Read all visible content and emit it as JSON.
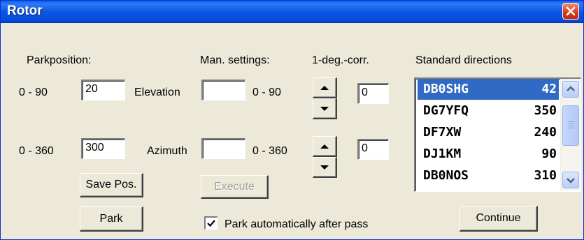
{
  "window": {
    "title": "Rotor",
    "close_icon": "close-x-icon"
  },
  "headers": {
    "parkposition": "Parkposition:",
    "man_settings": "Man. settings:",
    "deg_corr": "1-deg.-corr.",
    "standard_directions": "Standard directions"
  },
  "park": {
    "elevation_range": "0 - 90",
    "elevation_value": "20",
    "azimuth_range": "0 - 360",
    "azimuth_value": "300"
  },
  "manual": {
    "elevation_label": "Elevation",
    "elevation_value": "",
    "elevation_range": "0 - 90",
    "azimuth_label": "Azimuth",
    "azimuth_value": "",
    "azimuth_range": "0 - 360"
  },
  "correction": {
    "elevation_value": "0",
    "azimuth_value": "0"
  },
  "directions": [
    {
      "call": "DB0SHG",
      "deg": "42",
      "selected": true
    },
    {
      "call": "DG7YFQ",
      "deg": "350",
      "selected": false
    },
    {
      "call": "DF7XW",
      "deg": "240",
      "selected": false
    },
    {
      "call": "DJ1KM",
      "deg": "90",
      "selected": false
    },
    {
      "call": "DB0NOS",
      "deg": "310",
      "selected": false
    }
  ],
  "buttons": {
    "save_pos": "Save Pos.",
    "execute": "Execute",
    "park": "Park",
    "continue": "Continue"
  },
  "auto_park": {
    "label": "Park automatically after pass",
    "checked": true
  },
  "colors": {
    "titlebar": "#0955E5",
    "selection": "#316AC5",
    "dialog_bg": "#ECE9D8"
  }
}
